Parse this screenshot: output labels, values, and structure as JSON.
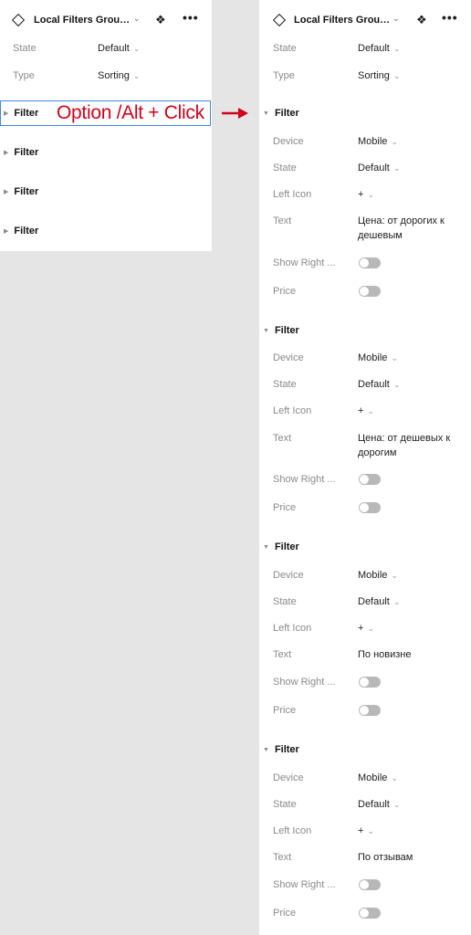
{
  "colors": {
    "accent_red": "#d0021b",
    "selection_blue": "#3c8ae6",
    "toggle_off": "#b8b8b8"
  },
  "component_title": "Local Filters Grou…",
  "props": {
    "state_label": "State",
    "state_value": "Default",
    "type_label": "Type",
    "type_value": "Sorting"
  },
  "left_filters": [
    "Filter",
    "Filter",
    "Filter",
    "Filter"
  ],
  "annotation": "Option /Alt + Click",
  "field_labels": {
    "device": "Device",
    "state": "State",
    "left_icon": "Left Icon",
    "text": "Text",
    "show_right": "Show Right ...",
    "price": "Price"
  },
  "left_icon_value": "+",
  "filters": [
    {
      "title": "Filter",
      "device": "Mobile",
      "state": "Default",
      "text": "Цена: от дорогих к дешевым"
    },
    {
      "title": "Filter",
      "device": "Mobile",
      "state": "Default",
      "text": "Цена: от дешевых к дорогим"
    },
    {
      "title": "Filter",
      "device": "Mobile",
      "state": "Default",
      "text": "По новизне"
    },
    {
      "title": "Filter",
      "device": "Mobile",
      "state": "Default",
      "text": "По отзывам"
    }
  ]
}
